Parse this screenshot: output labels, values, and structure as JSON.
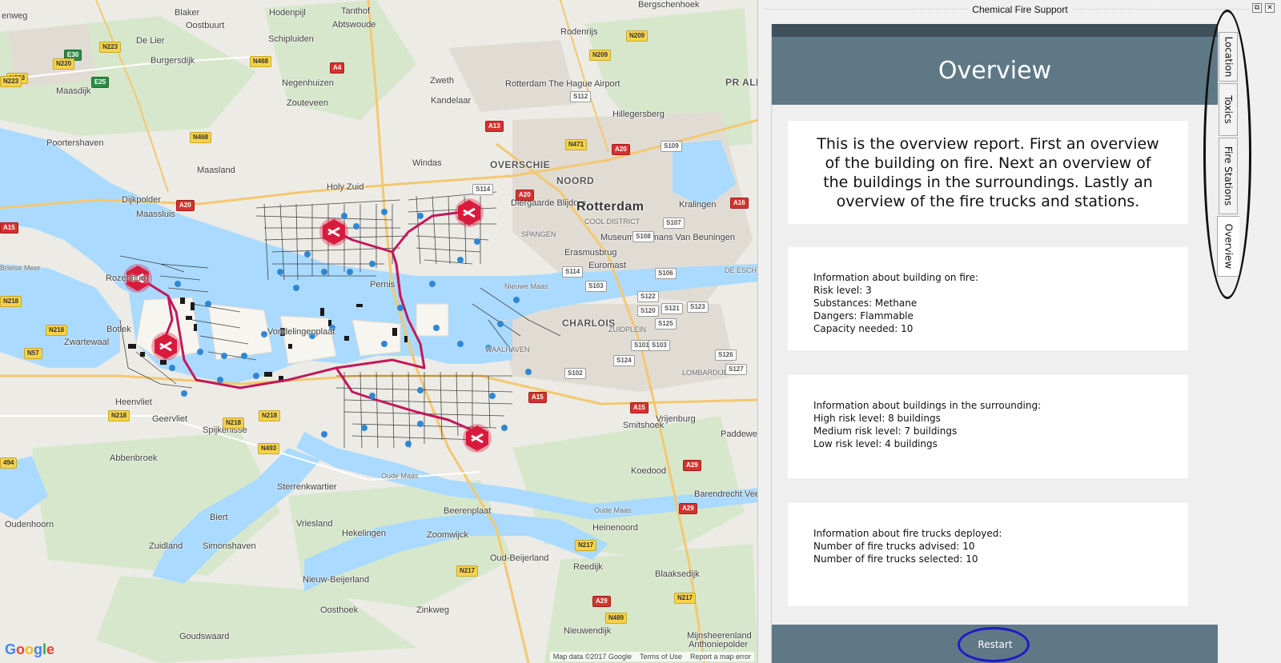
{
  "window": {
    "title": "Chemical Fire Support"
  },
  "map": {
    "places": [
      {
        "name": "enweg",
        "cls": ""
      },
      {
        "name": "Blaker",
        "cls": ""
      },
      {
        "name": "Oostbuurt",
        "cls": ""
      },
      {
        "name": "Hodenpijl",
        "cls": ""
      },
      {
        "name": "Tanthof",
        "cls": ""
      },
      {
        "name": "Abtswoude",
        "cls": ""
      },
      {
        "name": "Bergschenhoek",
        "cls": ""
      },
      {
        "name": "Rodenrijs",
        "cls": ""
      },
      {
        "name": "De Lier",
        "cls": ""
      },
      {
        "name": "Schipluiden",
        "cls": ""
      },
      {
        "name": "Burgersdijk",
        "cls": ""
      },
      {
        "name": "Maasdijk",
        "cls": ""
      },
      {
        "name": "Negenhuizen",
        "cls": ""
      },
      {
        "name": "Zouteveen",
        "cls": ""
      },
      {
        "name": "Zweth",
        "cls": ""
      },
      {
        "name": "Kandelaar",
        "cls": ""
      },
      {
        "name": "Rotterdam The Hague Airport",
        "cls": ""
      },
      {
        "name": "Hillegersberg",
        "cls": ""
      },
      {
        "name": "Poortershaven",
        "cls": ""
      },
      {
        "name": "Maasland",
        "cls": ""
      },
      {
        "name": "Windas",
        "cls": ""
      },
      {
        "name": "OVERSCHIE",
        "cls": "mid"
      },
      {
        "name": "NOORD",
        "cls": "mid"
      },
      {
        "name": "Dijkpolder",
        "cls": ""
      },
      {
        "name": "Holy Zuid",
        "cls": ""
      },
      {
        "name": "Diergaarde Blijdorp",
        "cls": ""
      },
      {
        "name": "Rotterdam",
        "cls": "big"
      },
      {
        "name": "Kralingen",
        "cls": ""
      },
      {
        "name": "Maassluis",
        "cls": ""
      },
      {
        "name": "COOL DISTRICT",
        "cls": "small"
      },
      {
        "name": "SPANGEN",
        "cls": "small"
      },
      {
        "name": "Museum Boijmans Van Beuningen",
        "cls": ""
      },
      {
        "name": "Erasmusbrug",
        "cls": ""
      },
      {
        "name": "Euromast",
        "cls": ""
      },
      {
        "name": "Nieuwe Maas",
        "cls": "small"
      },
      {
        "name": "Botlek",
        "cls": ""
      },
      {
        "name": "Zwartewaal",
        "cls": ""
      },
      {
        "name": "Vondelingenplaat",
        "cls": ""
      },
      {
        "name": "CHARLOIS",
        "cls": "mid"
      },
      {
        "name": "ZUIDPLEIN",
        "cls": "small"
      },
      {
        "name": "WAALHAVEN",
        "cls": "small"
      },
      {
        "name": "LOMBARDIJEN",
        "cls": "small"
      },
      {
        "name": "Heenvliet",
        "cls": ""
      },
      {
        "name": "Geervliet",
        "cls": ""
      },
      {
        "name": "Spijkenisse",
        "cls": ""
      },
      {
        "name": "Smitshoek",
        "cls": ""
      },
      {
        "name": "Vrijenburg",
        "cls": ""
      },
      {
        "name": "Paddewei",
        "cls": ""
      },
      {
        "name": "Abbenbroek",
        "cls": ""
      },
      {
        "name": "Koedood",
        "cls": ""
      },
      {
        "name": "Sterrenkwartier",
        "cls": ""
      },
      {
        "name": "Barendrecht Veer",
        "cls": ""
      },
      {
        "name": "Biert",
        "cls": ""
      },
      {
        "name": "Beerenplaat",
        "cls": ""
      },
      {
        "name": "Oudenhoorn",
        "cls": ""
      },
      {
        "name": "Vriesland",
        "cls": ""
      },
      {
        "name": "Hekelingen",
        "cls": ""
      },
      {
        "name": "Zoomwijck",
        "cls": ""
      },
      {
        "name": "Heinenoord",
        "cls": ""
      },
      {
        "name": "Zuidland",
        "cls": ""
      },
      {
        "name": "Simonshaven",
        "cls": ""
      },
      {
        "name": "Oud-Beijerland",
        "cls": ""
      },
      {
        "name": "Reedijk",
        "cls": ""
      },
      {
        "name": "Nieuw-Beijerland",
        "cls": ""
      },
      {
        "name": "Blaaksedijk",
        "cls": ""
      },
      {
        "name": "Oosthoek",
        "cls": ""
      },
      {
        "name": "Zinkweg",
        "cls": ""
      },
      {
        "name": "Goudswaard",
        "cls": ""
      },
      {
        "name": "Nieuwendijk",
        "cls": ""
      },
      {
        "name": "Mijnsheerenland",
        "cls": ""
      },
      {
        "name": "Anthoniepolder",
        "cls": ""
      },
      {
        "name": "Oude Maas",
        "cls": "small"
      },
      {
        "name": "Oude Maas",
        "cls": "small"
      },
      {
        "name": "Brielse Meer",
        "cls": "small"
      },
      {
        "name": "Rozenburg",
        "cls": ""
      },
      {
        "name": "Pernis",
        "cls": ""
      },
      {
        "name": "PR ALEX.",
        "cls": "mid"
      },
      {
        "name": "DE ESCH",
        "cls": "small"
      }
    ],
    "shields": [
      {
        "label": "E30",
        "cls": "g"
      },
      {
        "label": "N223",
        "cls": "y"
      },
      {
        "label": "N220",
        "cls": "y"
      },
      {
        "label": "E25",
        "cls": "g"
      },
      {
        "label": "N223",
        "cls": "y"
      },
      {
        "label": "A4",
        "cls": "r"
      },
      {
        "label": "N468",
        "cls": "y"
      },
      {
        "label": "N209",
        "cls": "y"
      },
      {
        "label": "N209",
        "cls": "y"
      },
      {
        "label": "S112",
        "cls": "w"
      },
      {
        "label": "A13",
        "cls": "r"
      },
      {
        "label": "N471",
        "cls": "y"
      },
      {
        "label": "A20",
        "cls": "r"
      },
      {
        "label": "S109",
        "cls": "w"
      },
      {
        "label": "N468",
        "cls": "y"
      },
      {
        "label": "A20",
        "cls": "r"
      },
      {
        "label": "S114",
        "cls": "w"
      },
      {
        "label": "A20",
        "cls": "r"
      },
      {
        "label": "A16",
        "cls": "r"
      },
      {
        "label": "A15",
        "cls": "r"
      },
      {
        "label": "S107",
        "cls": "w"
      },
      {
        "label": "S108",
        "cls": "w"
      },
      {
        "label": "S114",
        "cls": "w"
      },
      {
        "label": "S103",
        "cls": "w"
      },
      {
        "label": "S106",
        "cls": "w"
      },
      {
        "label": "S122",
        "cls": "w"
      },
      {
        "label": "S120",
        "cls": "w"
      },
      {
        "label": "S123",
        "cls": "w"
      },
      {
        "label": "S121",
        "cls": "w"
      },
      {
        "label": "S125",
        "cls": "w"
      },
      {
        "label": "S101",
        "cls": "w"
      },
      {
        "label": "S103",
        "cls": "w"
      },
      {
        "label": "S126",
        "cls": "w"
      },
      {
        "label": "S124",
        "cls": "w"
      },
      {
        "label": "S102",
        "cls": "w"
      },
      {
        "label": "S127",
        "cls": "w"
      },
      {
        "label": "N218",
        "cls": "y"
      },
      {
        "label": "N57",
        "cls": "y"
      },
      {
        "label": "A15",
        "cls": "r"
      },
      {
        "label": "A15",
        "cls": "r"
      },
      {
        "label": "N218",
        "cls": "y"
      },
      {
        "label": "N218",
        "cls": "y"
      },
      {
        "label": "N218",
        "cls": "y"
      },
      {
        "label": "N493",
        "cls": "y"
      },
      {
        "label": "A29",
        "cls": "r"
      },
      {
        "label": "A29",
        "cls": "r"
      },
      {
        "label": "N217",
        "cls": "y"
      },
      {
        "label": "N217",
        "cls": "y"
      },
      {
        "label": "A29",
        "cls": "r"
      },
      {
        "label": "N217",
        "cls": "y"
      },
      {
        "label": "N489",
        "cls": "y"
      },
      {
        "label": "N223",
        "cls": "y"
      },
      {
        "label": "N218",
        "cls": "y"
      },
      {
        "label": "494",
        "cls": "y"
      },
      {
        "label": "A15",
        "cls": "r"
      }
    ],
    "logo": "Google",
    "footer": [
      "Map data ©2017 Google",
      "Terms of Use",
      "Report a map error"
    ]
  },
  "tabs": [
    {
      "label": "Location"
    },
    {
      "label": "Toxics"
    },
    {
      "label": "Fire Stations"
    },
    {
      "label": "Overview"
    }
  ],
  "overview": {
    "heading": "Overview",
    "intro": "This is the overview report. First an overview of the building on fire. Next an overview of the buildings in the surroundings. Lastly an overview of the fire trucks and stations.",
    "building": {
      "title": "Information about building on fire:",
      "risk": "Risk level: 3",
      "substances": "Substances: Methane",
      "dangers": "Dangers: Flammable",
      "capacity": "Capacity needed: 10"
    },
    "surroundings": {
      "title": "Information about buildings in the surrounding:",
      "high": "High risk level: 8 buildings",
      "medium": "Medium risk level: 7 buildings",
      "low": "Low risk level: 4 buildings"
    },
    "trucks": {
      "title": "Information about fire trucks deployed:",
      "advised": "Number of fire trucks advised: 10",
      "selected": "Number of fire trucks selected: 10"
    },
    "restart_label": "Restart"
  },
  "colors": {
    "header": "#5f7886",
    "header_strip": "#3f505b",
    "route": "#c2185b",
    "station_marker": "#d81b3c",
    "building_dot": "#2f87d4",
    "water": "#aadaff"
  }
}
